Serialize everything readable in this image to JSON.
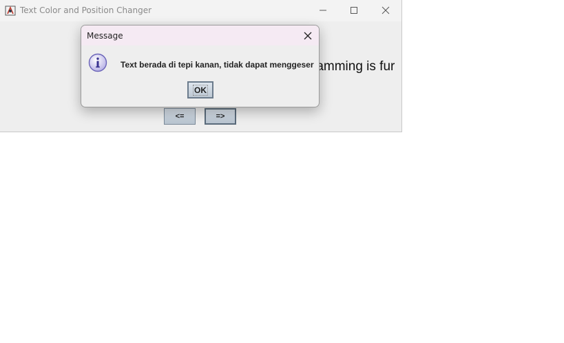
{
  "window": {
    "title": "Text Color and Position Changer",
    "icon": "java-app-icon",
    "controls": [
      "minimize-icon",
      "maximize-icon",
      "close-icon"
    ]
  },
  "content": {
    "display_text": "ramming is fur",
    "left_button_label": "<=",
    "right_button_label": "=>"
  },
  "dialog": {
    "title": "Message",
    "icon": "info-icon",
    "message": "Text berada di tepi kanan, tidak dapat menggeser",
    "ok_label": "OK"
  },
  "colors": {
    "dialog_titlebar": "#f5eaf3",
    "window_bg": "#eeeeee",
    "button_gradient_top": "#d9e1ea",
    "button_gradient_bottom": "#b8c4d0"
  }
}
